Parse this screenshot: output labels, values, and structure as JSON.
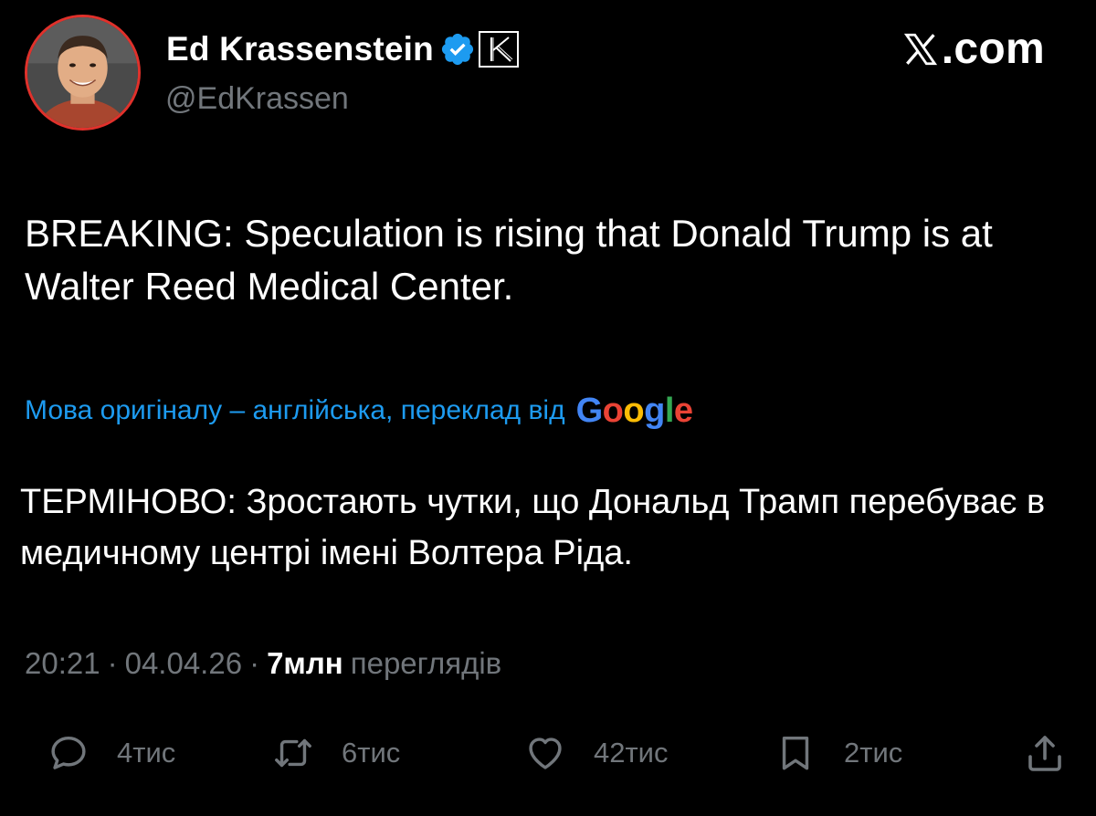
{
  "author": {
    "display_name": "Ed Krassenstein",
    "handle": "@EdKrassen",
    "verified_icon": "verified-badge-icon",
    "affiliate_icon": "affiliate-k-icon",
    "affiliate_letter": "K"
  },
  "brand": {
    "logo_icon": "x-logo-icon",
    "logo_text": ".com"
  },
  "tweet": {
    "text": "BREAKING: Speculation is rising that Donald Trump is at Walter Reed Medical Center."
  },
  "translation": {
    "note": "Мова оригіналу – англійська, переклад від",
    "provider": "Google",
    "text": "ТЕРМІНОВО: Зростають чутки, що Дональд Трамп перебуває в медичному центрі імені Волтера Ріда."
  },
  "meta": {
    "time": "20:21",
    "date": "04.04.26",
    "separator": "·",
    "views_count": "7млн",
    "views_label": "переглядів"
  },
  "actions": {
    "reply": {
      "icon": "reply-icon",
      "count": "4тис"
    },
    "repost": {
      "icon": "repost-icon",
      "count": "6тис"
    },
    "like": {
      "icon": "heart-icon",
      "count": "42тис"
    },
    "bookmark": {
      "icon": "bookmark-icon",
      "count": "2тис"
    },
    "share": {
      "icon": "share-icon"
    }
  },
  "colors": {
    "background": "#000000",
    "text_primary": "#ffffff",
    "text_secondary": "#71767b",
    "link_blue": "#1d9bf0",
    "verified_blue": "#1d9bf0",
    "avatar_ring": "#e0312b"
  }
}
